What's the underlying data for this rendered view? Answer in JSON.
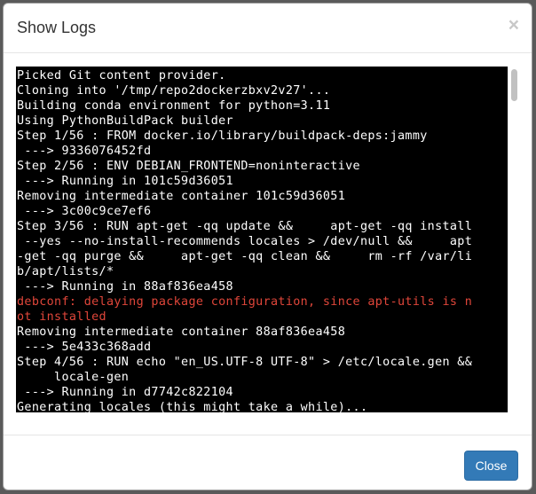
{
  "dialog": {
    "title": "Show Logs",
    "close_icon": "×",
    "close_button_label": "Close"
  },
  "log": {
    "lines": [
      {
        "text": "Picked Git content provider.",
        "type": "normal"
      },
      {
        "text": "Cloning into '/tmp/repo2dockerzbxv2v27'...",
        "type": "normal"
      },
      {
        "text": "Building conda environment for python=3.11",
        "type": "normal"
      },
      {
        "text": "Using PythonBuildPack builder",
        "type": "normal"
      },
      {
        "text": "Step 1/56 : FROM docker.io/library/buildpack-deps:jammy",
        "type": "normal"
      },
      {
        "text": " ---> 9336076452fd",
        "type": "normal"
      },
      {
        "text": "Step 2/56 : ENV DEBIAN_FRONTEND=noninteractive",
        "type": "normal"
      },
      {
        "text": " ---> Running in 101c59d36051",
        "type": "normal"
      },
      {
        "text": "Removing intermediate container 101c59d36051",
        "type": "normal"
      },
      {
        "text": " ---> 3c00c9ce7ef6",
        "type": "normal"
      },
      {
        "text": "Step 3/56 : RUN apt-get -qq update &&     apt-get -qq install",
        "type": "normal"
      },
      {
        "text": " --yes --no-install-recommends locales > /dev/null &&     apt",
        "type": "normal"
      },
      {
        "text": "-get -qq purge &&     apt-get -qq clean &&     rm -rf /var/li",
        "type": "normal"
      },
      {
        "text": "b/apt/lists/*",
        "type": "normal"
      },
      {
        "text": " ---> Running in 88af836ea458",
        "type": "normal"
      },
      {
        "text": "debconf: delaying package configuration, since apt-utils is n",
        "type": "error"
      },
      {
        "text": "ot installed",
        "type": "error"
      },
      {
        "text": "Removing intermediate container 88af836ea458",
        "type": "normal"
      },
      {
        "text": " ---> 5e433c368add",
        "type": "normal"
      },
      {
        "text": "Step 4/56 : RUN echo \"en_US.UTF-8 UTF-8\" > /etc/locale.gen &&",
        "type": "normal"
      },
      {
        "text": "     locale-gen",
        "type": "normal"
      },
      {
        "text": " ---> Running in d7742c822104",
        "type": "normal"
      },
      {
        "text": "Generating locales (this might take a while)...",
        "type": "normal"
      }
    ]
  },
  "colors": {
    "terminal_bg": "#000000",
    "terminal_text": "#ffffff",
    "error_text": "#e0463a",
    "primary_button": "#337ab7"
  }
}
